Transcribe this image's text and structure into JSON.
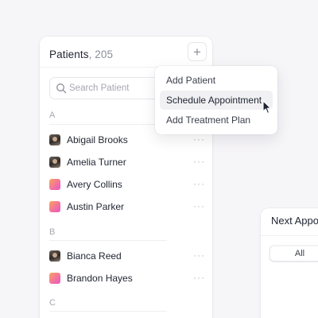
{
  "patients": {
    "title": "Patients",
    "count_text": ", 205",
    "add_icon": "+",
    "search_placeholder": "Search Patient",
    "sections": [
      {
        "letter": "A",
        "items": [
          {
            "name": "Abigail Brooks",
            "avatar": "photo"
          },
          {
            "name": "Amelia Turner",
            "avatar": "photo"
          },
          {
            "name": "Avery Collins",
            "avatar": "gradient"
          },
          {
            "name": "Austin Parker",
            "avatar": "gradient"
          }
        ]
      },
      {
        "letter": "B",
        "items": [
          {
            "name": "Bianca Reed",
            "avatar": "photo"
          },
          {
            "name": "Brandon Hayes",
            "avatar": "gradient"
          }
        ]
      },
      {
        "letter": "C",
        "items": []
      }
    ],
    "more_icon": "···"
  },
  "menu": {
    "items": [
      {
        "label": "Add Patient",
        "hover": false
      },
      {
        "label": "Schedule Appointment",
        "hover": true
      },
      {
        "label": "Add Treatment Plan",
        "hover": false
      }
    ]
  },
  "next_appointments": {
    "title": "Next Appointments",
    "filters": [
      "All"
    ]
  },
  "colors": {
    "background": "#f6f5f8",
    "panel": "#ffffff",
    "text": "#1f2430",
    "muted": "#8b8f98",
    "avatar_gradient_start": "#f9a45b",
    "avatar_gradient_end": "#e45bc0"
  }
}
